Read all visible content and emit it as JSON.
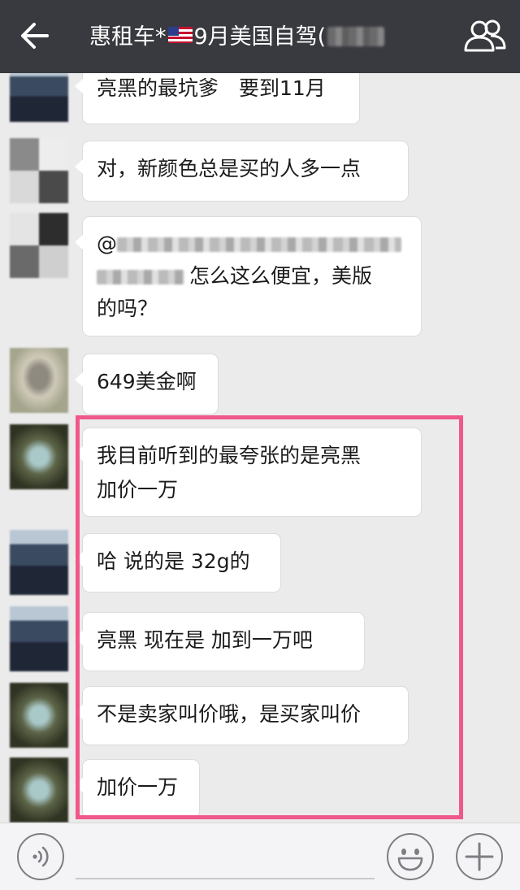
{
  "header": {
    "title": "惠租车*",
    "title_suffix": "9月美国自驾(",
    "back_icon": "arrow-left-icon",
    "group_icon": "group-members-icon"
  },
  "messages": [
    {
      "text": "亮黑的最坑爹　要到11月"
    },
    {
      "text": "对，新颜色总是买的人多一点"
    },
    {
      "prefix": "@",
      "text": "怎么这么便宜，美版",
      "text2": "的吗？"
    },
    {
      "text": "649美金啊"
    },
    {
      "text": "我目前听到的最夸张的是亮黑",
      "text2": "加价一万"
    },
    {
      "text": "哈  说的是 32g的"
    },
    {
      "text": "亮黑  现在是  加到一万吧"
    },
    {
      "text": "不是卖家叫价哦，是买家叫价"
    },
    {
      "text": "加价一万"
    }
  ],
  "colors": {
    "topbar": "#393a3f",
    "chat_bg": "#ebebeb",
    "highlight": "#f0588a"
  },
  "input_bar": {
    "voice_icon": "voice-icon",
    "emoji_icon": "emoji-icon",
    "plus_icon": "plus-icon"
  }
}
